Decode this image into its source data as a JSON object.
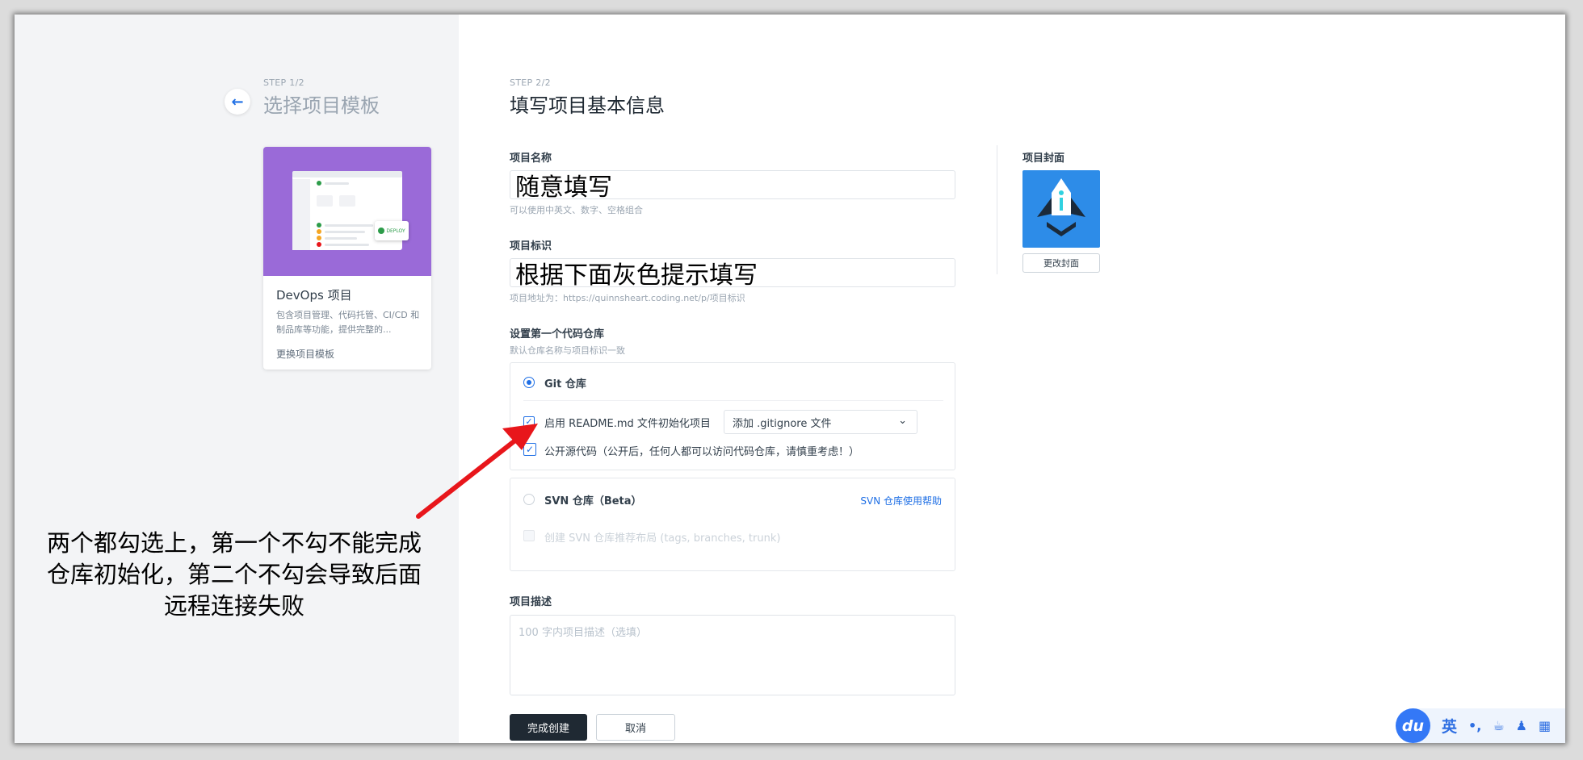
{
  "left_panel": {
    "step_label": "STEP 1/2",
    "step_title": "选择项目模板",
    "template": {
      "name": "DevOps 项目",
      "description": "包含项目管理、代码托管、CI/CD 和制品库等功能，提供完整的...",
      "change_link": "更换项目模板",
      "mock_badge": "DEPLOY"
    }
  },
  "form": {
    "step_label": "STEP 2/2",
    "step_title": "填写项目基本信息",
    "project_name": {
      "label": "项目名称",
      "value": "随意填写",
      "hint": "可以使用中英文、数字、空格组合"
    },
    "project_id": {
      "label": "项目标识",
      "value": "根据下面灰色提示填写",
      "hint": "项目地址为：https://quinnsheart.coding.net/p/项目标识"
    },
    "repo": {
      "label": "设置第一个代码仓库",
      "hint": "默认仓库名称与项目标识一致",
      "git": {
        "label": "Git 仓库",
        "readme_label": "启用 README.md 文件初始化项目",
        "gitignore_select": "添加 .gitignore 文件",
        "public_label": "公开源代码（公开后，任何人都可以访问代码仓库，请慎重考虑！）"
      },
      "svn": {
        "label": "SVN 仓库（Beta）",
        "help_link": "SVN 仓库使用帮助",
        "layout_label": "创建 SVN 仓库推荐布局 (tags, branches, trunk)"
      }
    },
    "description": {
      "label": "项目描述",
      "placeholder": "100 字内项目描述（选填）"
    },
    "submit_label": "完成创建",
    "cancel_label": "取消"
  },
  "cover": {
    "label": "项目封面",
    "change_label": "更改封面"
  },
  "annotation": {
    "line1": "两个都勾选上，第一个不勾不能完成",
    "line2": "仓库初始化，第二个不勾会导致后面",
    "line3": "远程连接失败"
  },
  "ime_toolbar": {
    "logo": "du",
    "lang": "英"
  },
  "colors": {
    "accent": "#1f6fe5",
    "template_bg": "#9a6ad8",
    "cover_bg": "#2d8ce8",
    "primary_button": "#1f2933",
    "arrow": "#e8161b"
  }
}
